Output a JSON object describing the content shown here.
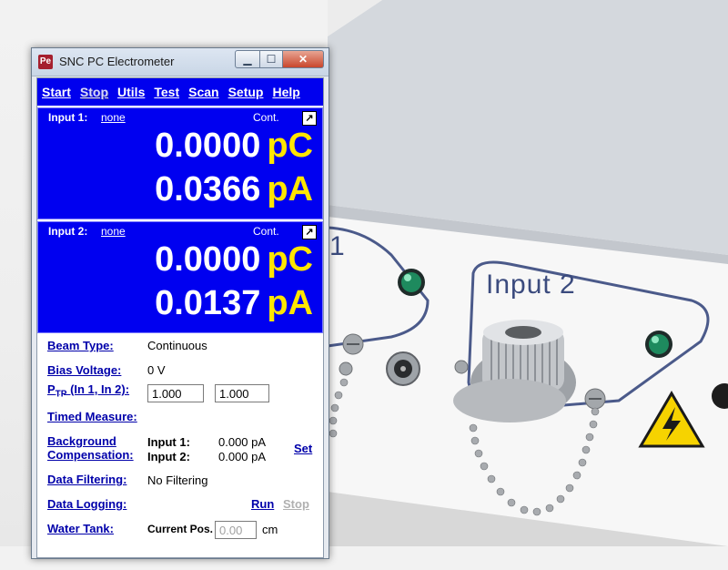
{
  "background": {
    "device_label_1": "1",
    "device_label_2": "Input 2"
  },
  "window": {
    "title": "SNC PC Electrometer",
    "app_icon": "Pe",
    "controls": {
      "minimize": "▁",
      "maximize": "☐",
      "close": "✕"
    }
  },
  "menu": [
    {
      "label": "Start"
    },
    {
      "label": "Stop"
    },
    {
      "label": "Utils"
    },
    {
      "label": "Test"
    },
    {
      "label": "Scan"
    },
    {
      "label": "Setup"
    },
    {
      "label": "Help"
    }
  ],
  "inputs": [
    {
      "label": "Input 1:",
      "source": "none",
      "mode": "Cont.",
      "popout_icon": "↗",
      "charge": "0.0000",
      "charge_unit": "pC",
      "current": "0.0366",
      "current_unit": "pA"
    },
    {
      "label": "Input 2:",
      "source": "none",
      "mode": "Cont.",
      "popout_icon": "↗",
      "charge": "0.0000",
      "charge_unit": "pC",
      "current": "0.0137",
      "current_unit": "pA"
    }
  ],
  "settings": {
    "beam_type": {
      "label": "Beam Type:",
      "value": "Continuous"
    },
    "bias_voltage": {
      "label": "Bias Voltage:",
      "value": "0 V"
    },
    "ptp": {
      "label_p": "P",
      "label_sub": "TP",
      "label_rest": " (In 1, In 2):",
      "in1": "1.000",
      "in2": "1.000"
    },
    "timed_measure": {
      "label": "Timed Measure:"
    },
    "background_comp": {
      "label_line1": "Background",
      "label_line2": "Compensation:",
      "input1_label": "Input 1:",
      "input1_value": "0.000 pA",
      "input2_label": "Input 2:",
      "input2_value": "0.000 pA",
      "set_label": "Set"
    },
    "data_filtering": {
      "label": "Data Filtering:",
      "value": "No Filtering"
    },
    "data_logging": {
      "label": "Data Logging:",
      "run": "Run",
      "stop": "Stop"
    },
    "water_tank": {
      "label": "Water Tank:",
      "pos_label": "Current Pos.",
      "pos_value": "0.00",
      "unit": "cm"
    }
  }
}
